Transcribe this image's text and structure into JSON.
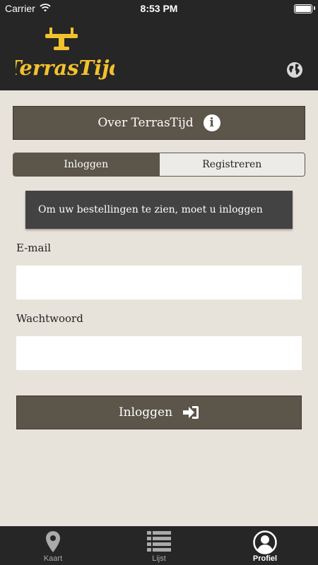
{
  "status_bar": {
    "carrier": "Carrier",
    "time": "8:53 PM"
  },
  "header": {
    "logo_text": "TerrasTijd",
    "globe_icon": "globe-icon",
    "accent_color": "#f2c12e"
  },
  "about_button": {
    "label": "Over TerrasTijd",
    "icon": "info-icon"
  },
  "tabs": [
    {
      "label": "Inloggen",
      "active": true
    },
    {
      "label": "Registreren",
      "active": false
    }
  ],
  "notice": "Om uw bestellingen te zien, moet u inloggen",
  "form": {
    "email_label": "E-mail",
    "email_value": "",
    "password_label": "Wachtwoord",
    "password_value": "",
    "submit_label": "Inloggen",
    "submit_icon": "sign-in-icon"
  },
  "tab_bar": [
    {
      "label": "Kaart",
      "icon": "map-pin-icon",
      "active": false
    },
    {
      "label": "Lijst",
      "icon": "list-icon",
      "active": false
    },
    {
      "label": "Profiel",
      "icon": "user-icon",
      "active": true
    }
  ],
  "colors": {
    "dark": "#262626",
    "brown": "#5b554a",
    "background": "#e8e3da",
    "notice": "#434343"
  }
}
